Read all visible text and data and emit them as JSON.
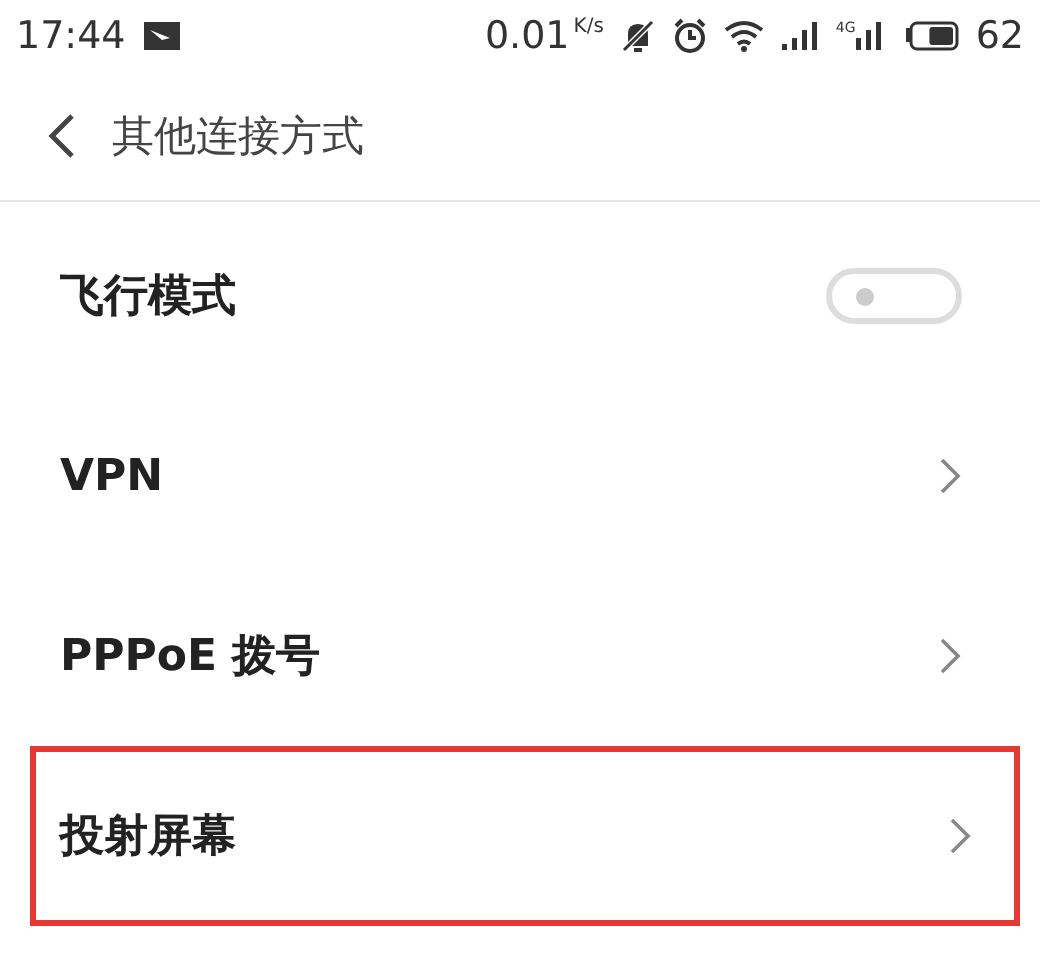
{
  "status_bar": {
    "time": "17:44",
    "speed": "0.01",
    "speed_unit": "K/s",
    "network_label": "4G",
    "battery": "62"
  },
  "header": {
    "title": "其他连接方式"
  },
  "items": [
    {
      "label": "飞行模式",
      "kind": "toggle",
      "on": false,
      "highlighted": false
    },
    {
      "label": "VPN",
      "kind": "link",
      "highlighted": false
    },
    {
      "label": "PPPoE 拨号",
      "kind": "link",
      "highlighted": false
    },
    {
      "label": "投射屏幕",
      "kind": "link",
      "highlighted": true
    }
  ]
}
